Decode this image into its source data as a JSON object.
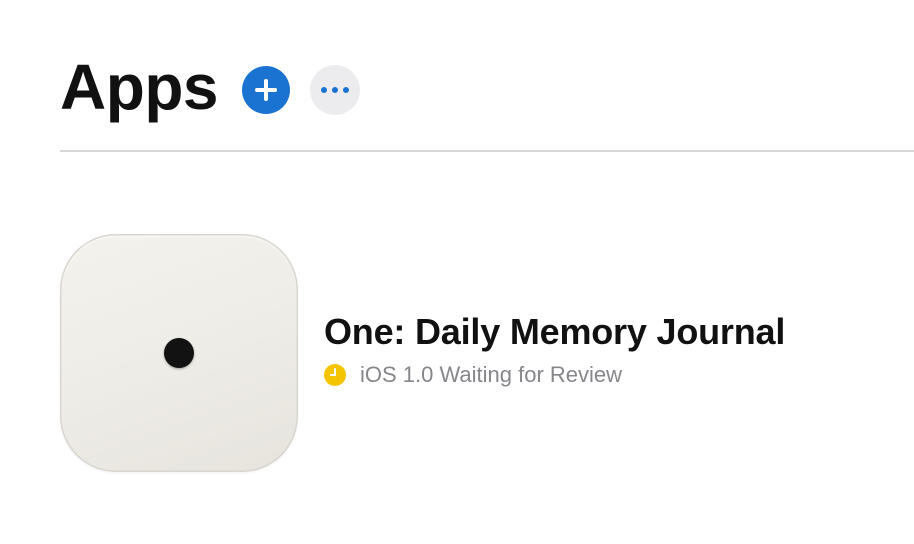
{
  "header": {
    "title": "Apps",
    "add_icon": "plus-icon",
    "more_icon": "ellipsis-icon"
  },
  "apps": [
    {
      "name": "One: Daily Memory Journal",
      "icon": "white-square-with-black-dot",
      "status": {
        "icon": "clock-icon",
        "color": "#f5c400",
        "text": "iOS 1.0 Waiting for Review"
      }
    }
  ],
  "colors": {
    "accent": "#1a73d0",
    "status_waiting": "#f5c400",
    "secondary_text": "#86868b"
  }
}
